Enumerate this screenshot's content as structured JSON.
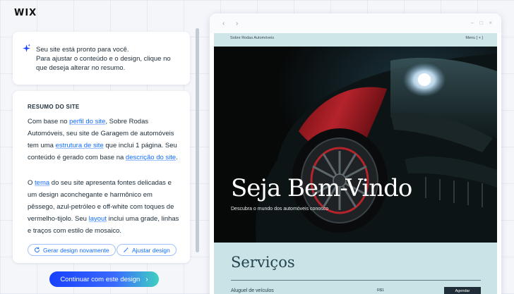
{
  "brand": {
    "logo": "WIX"
  },
  "intro": {
    "icon": "sparkle-icon",
    "line1": "Seu site está pronto para você.",
    "line2": "Para ajustar o conteúdo e o design, clique no",
    "line3": "que deseja alterar no resumo."
  },
  "summary": {
    "title": "RESUMO DO SITE",
    "p1": {
      "t1": "Com base no ",
      "link1": "perfil do site",
      "t2": ", Sobre Rodas Automóveis, seu site de Garagem de automóveis tem uma ",
      "link2": "estrutura de site",
      "t3": " que inclui 1 página. Seu conteúdo é gerado com base na ",
      "link3": "descrição do site",
      "t4": "."
    },
    "p2": {
      "t1": "O ",
      "link1": "tema",
      "t2": " do seu site apresenta fontes delicadas e um design aconchegante e harmônico em pêssego, azul-petróleo e off-white com toques de vermelho-tijolo. Seu ",
      "link2": "layout",
      "t3": " inclui uma grade, linhas e traços com estilo de mosaico."
    },
    "regenerate_label": "Gerar design novamente",
    "adjust_label": "Ajustar design"
  },
  "cta": {
    "label": "Continuar com este design",
    "arrow": "›"
  },
  "preview": {
    "nav_back": "‹",
    "nav_forward": "›",
    "window_controls": "– □ ×",
    "site_name": "Sobre Rodas Automóveis",
    "menu_label": "Menu [ + ]",
    "hero_title": "Seja Bem-Vindo",
    "hero_subtitle": "Descubra o mundo dos automóveis conosco",
    "services_title": "Serviços",
    "service_1_name": "Aluguel de veículos",
    "service_1_price": "R$1",
    "service_1_button": "Agendar"
  },
  "colors": {
    "accent": "#116dff",
    "cta_gradient_start": "#1740ff",
    "cta_gradient_end": "#3fd0c0",
    "site_background": "#c9e3e6",
    "hero_red": "#b5232b"
  }
}
